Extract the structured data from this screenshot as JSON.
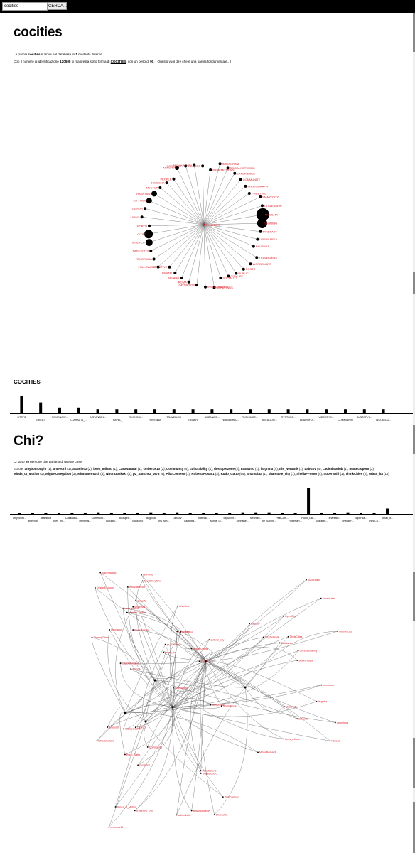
{
  "search": {
    "value": "cocities",
    "button": "CERCA..."
  },
  "title": "cocities",
  "intro": {
    "line1_a": "La parola ",
    "line1_word": "cocities",
    "line1_b": " si trova nel database in ",
    "line1_count": "1",
    "line1_c": " modalità diverse",
    "line2_a": "Con il numero di identificazione ",
    "line2_id": "120508",
    "line2_b": " si manifesta sotto forma di ",
    "line2_form": "COCITIES",
    "line2_c": ", con un peso di ",
    "line2_weight": "90",
    "line2_d": ". ( Questo vuol dire che è una parola fondamentale.. )"
  },
  "word_graph": {
    "labels": [
      "WEBEMOTIONS",
      "INSTAGRAM",
      "SOCIALNETWORK",
      "EXPERIENCE",
      "COMMUNITY",
      "PHOTOGRAPHY",
      "TWEETING",
      "SMARTCITY",
      "CITIZENSHIP",
      "MOBILITY",
      "SHARING",
      "TAKEPART",
      "URBANAREA",
      "RAVENNA",
      "TRAVELLERS",
      "WORDSNAPS",
      "POSTS",
      "PUBLIC",
      "CITYLIFE",
      "SOCIALITY",
      "DEPUTINGS",
      "INSTAGRAMCITY",
      "GEOSPOTS",
      "ROMA",
      "MILANO",
      "DIGITAL",
      "CREATIVE",
      "FOLLOWERS",
      "PANORAMA",
      "TWEETCITY",
      "INTERCITY",
      "CITIES",
      "PORTO",
      "LIVING",
      "DESIGN",
      "CITYVIEW",
      "HASHTAGS",
      "MEETUP",
      "BOLOGNA",
      "PEOPLE",
      "ARTCITY",
      "SOCIALCITY",
      "ANGOLAZIONI",
      "CULTURE"
    ],
    "hub": "COCITIES"
  },
  "section1_heading": "COCITIES",
  "bar_chart_1": {
    "labels": [
      "HTTPS",
      "GREAT",
      "SOVIENOW...",
      "O-ARAD71_...",
      "INSTANTAN...",
      "TRAVEL_",
      "RYONCSI...",
      "RAVENNA",
      "TRAVELLED",
      "GENER",
      "URBANIFE...",
      "WANDERLU...",
      "TURISMOE...",
      "INSTAGOO...",
      "RYSTOOT...",
      "BEAUTIFU...",
      "VIDEOTYC...",
      "COMMINNIN",
      "SUSTOPYL...",
      "INSTAGOO..."
    ],
    "values": [
      10,
      6,
      3,
      3,
      2,
      2,
      2,
      2,
      2,
      2,
      2,
      2,
      2,
      2,
      2,
      2,
      2,
      2,
      2,
      2
    ]
  },
  "section2_heading": "Chi?",
  "people": {
    "count_a": "Ci sono ",
    "count": "29",
    "count_b": " persone che parlano di queste cose.",
    "prefix": "Eccole: ",
    "list": [
      {
        "name": "amybourouphr",
        "n": "1"
      },
      {
        "name": "antevorti",
        "n": "1"
      },
      {
        "name": "asaminoz",
        "n": "2"
      },
      {
        "name": "bees_milano",
        "n": "1"
      },
      {
        "name": "CasaNatural",
        "n": "1"
      },
      {
        "name": "cerberus13",
        "n": "2"
      },
      {
        "name": "Community",
        "n": "4"
      },
      {
        "name": "culturability",
        "n": "1"
      },
      {
        "name": "dostoperzone",
        "n": "2"
      },
      {
        "name": "EAMamo",
        "n": "1"
      },
      {
        "name": "fargnina",
        "n": "4"
      },
      {
        "name": "Iris_Network",
        "n": "1"
      },
      {
        "name": "LabGov",
        "n": "4"
      },
      {
        "name": "Laolmbaadub",
        "n": "1"
      },
      {
        "name": "mattecloporo",
        "n": "2"
      },
      {
        "name": "Minds_ut_Motion",
        "n": "1"
      },
      {
        "name": "MiguelOrtegabon",
        "n": "3"
      },
      {
        "name": "MinnaBernardi",
        "n": "4"
      },
      {
        "name": "Nfrontzoskaki",
        "n": "4"
      },
      {
        "name": "pz_Sanchez_1978",
        "n": "4"
      },
      {
        "name": "PilarComeso",
        "n": "1"
      },
      {
        "name": "RobertaRosa01",
        "n": "3"
      },
      {
        "name": "Rudo_Gatto",
        "n": "64"
      },
      {
        "name": "Sharaubta",
        "n": "1"
      },
      {
        "name": "shareable_city",
        "n": "1"
      },
      {
        "name": "SheilaFFoster",
        "n": "4"
      },
      {
        "name": "SuperBaiti",
        "n": "1"
      },
      {
        "name": "ThinkCities",
        "n": "2"
      },
      {
        "name": "urban_ita",
        "n": "13"
      }
    ]
  },
  "bar_chart_2": {
    "labels": [
      "amybouro...",
      "antevorti",
      "asaminoz",
      "bees_mil...",
      "CasaNatu...",
      "cerberus...",
      "Communit...",
      "culturab...",
      "dostoper...",
      "EAMamo",
      "fargnina",
      "Iris_Net...",
      "LabGov",
      "Laolmba...",
      "matteclo...",
      "Minds_ut...",
      "MiguelOr...",
      "MinnaBer...",
      "Nfrontzo...",
      "pz_Sanch...",
      "PilarCom...",
      "RobertaR...",
      "Rudo_Gat...",
      "Sharaubt...",
      "shareabl...",
      "SheilaFF...",
      "SuperBai...",
      "ThinkCit...",
      "urban_it..."
    ],
    "values": [
      1,
      1,
      2,
      1,
      1,
      2,
      4,
      1,
      2,
      1,
      4,
      1,
      4,
      1,
      2,
      1,
      3,
      4,
      4,
      4,
      1,
      3,
      64,
      1,
      1,
      4,
      1,
      2,
      13
    ]
  },
  "people_graph": {
    "labels": [
      "HumanCoCities",
      "DesignEcology",
      "casa_madrid",
      "SharingCities",
      "vivecafe",
      "Innovator",
      "cityFinder",
      "InnovationBot",
      "FeedStoryTime",
      "urbanista",
      "placemaking",
      "pz_Sanchez",
      "Trends",
      "LabGov",
      "CitySociety",
      "cultural_city",
      "socialBot",
      "LaboMatic",
      "MiguelOrtega",
      "Laolmb",
      "urban_ita",
      "Rudo_Gatto",
      "Community",
      "asaminoz",
      "CoCities",
      "SheilaFoster",
      "RobertaRosa",
      "CivicTech",
      "CityOfBologna",
      "GreenCities",
      "MobilityLab",
      "SmartPeople",
      "Bizzeko",
      "citizensSharing",
      "OpenCity",
      "UrbanLabs",
      "ShareCity",
      "FabLab",
      "coworking",
      "commons",
      "SuperBaiti",
      "ThinkCities",
      "EAMamo",
      "fargnina",
      "bees_milano",
      "Iris_Network",
      "CasaNatural",
      "cerberus13",
      "culturability",
      "mattecloporo",
      "Minds_ut_Motion",
      "MinnaBernardi",
      "Nfrontzoskaki",
      "PilarComeso",
      "Sharaubta",
      "shareable_city",
      "dostoperzone",
      "antevorti",
      "amybourouphr"
    ]
  }
}
